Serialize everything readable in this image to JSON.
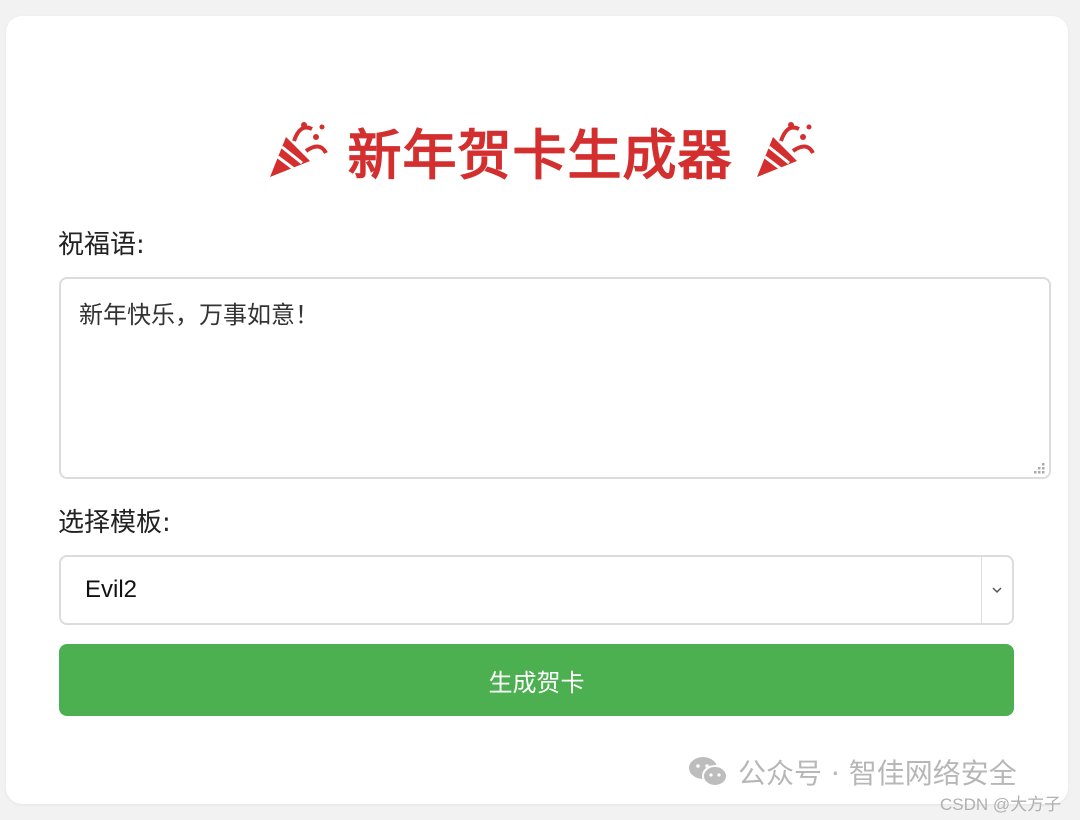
{
  "header": {
    "title": "新年贺卡生成器",
    "left_icon": "party-popper-icon",
    "right_icon": "party-popper-icon"
  },
  "form": {
    "message_label": "祝福语:",
    "message_value": "新年快乐，万事如意！",
    "template_label": "选择模板:",
    "template_selected": "Evil2",
    "generate_label": "生成贺卡"
  },
  "watermark": {
    "icon": "wechat-icon",
    "text": "公众号 · 智佳网络安全",
    "csdn": "CSDN @大方子"
  },
  "colors": {
    "title": "#d32f2f",
    "button": "#4caf50",
    "border": "#dcdcdc"
  }
}
